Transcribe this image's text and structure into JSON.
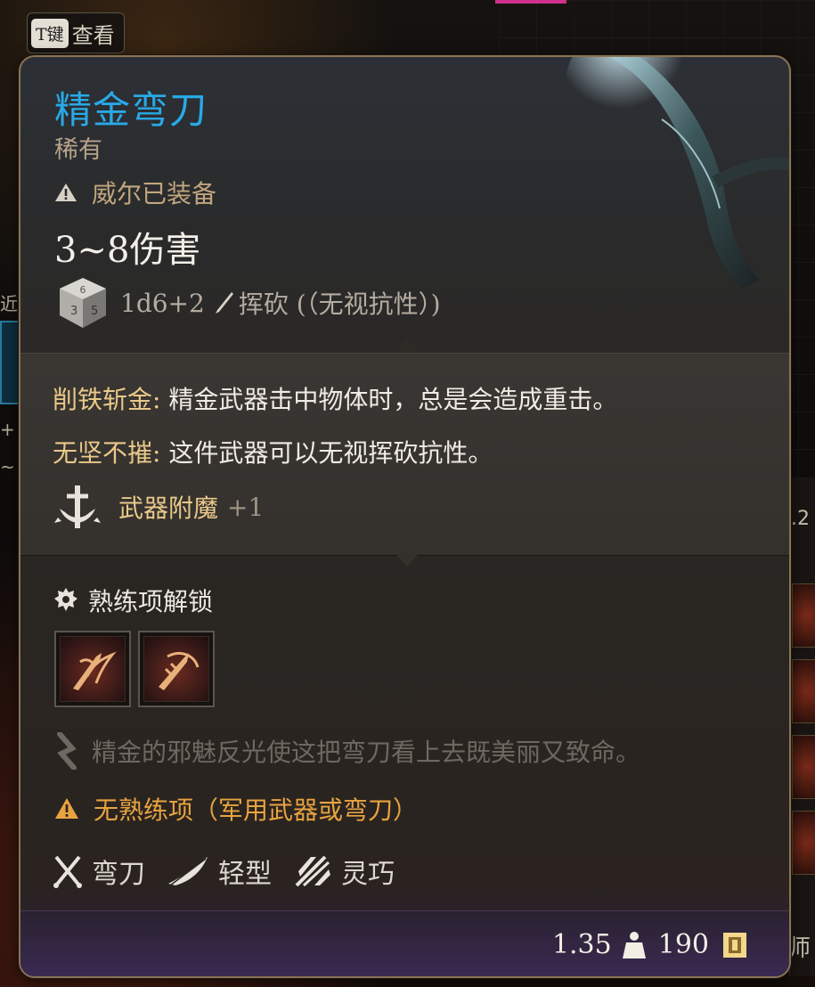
{
  "hint": {
    "key": "T键",
    "label": "查看"
  },
  "item": {
    "name": "精金弯刀",
    "rarity": "稀有",
    "equipped_by": "威尔已装备",
    "damage": "3~8伤害",
    "dice": "1d6+2",
    "damage_type": "挥砍 (（无视抗性）)"
  },
  "passives": [
    {
      "name": "削铁斩金:",
      "desc": "精金武器击中物体时，总是会造成重击。"
    },
    {
      "name": "无坚不摧:",
      "desc": "这件武器可以无视挥砍抗性。"
    }
  ],
  "enchant": {
    "label": "武器附魔",
    "value": "+1"
  },
  "proficiency": {
    "header": "熟练项解锁",
    "actions": [
      "weapon-action-icon",
      "weapon-action-icon"
    ]
  },
  "flavor": "精金的邪魅反光使这把弯刀看上去既美丽又致命。",
  "warning": "无熟练项（军用武器或弯刀）",
  "tags": [
    {
      "icon": "crossed-swords-icon",
      "label": "弯刀"
    },
    {
      "icon": "feather-icon",
      "label": "轻型"
    },
    {
      "icon": "agility-icon",
      "label": "灵巧"
    }
  ],
  "footer": {
    "weight": "1.35",
    "price": "190"
  },
  "background": {
    "right_text": ".2",
    "right_text2": "师",
    "left_frags": [
      "近战",
      "+",
      "~"
    ]
  },
  "colors": {
    "title": "#29a9e6",
    "passive_name": "#e9c98a",
    "warning": "#e8a340",
    "border": "#8a7355"
  }
}
